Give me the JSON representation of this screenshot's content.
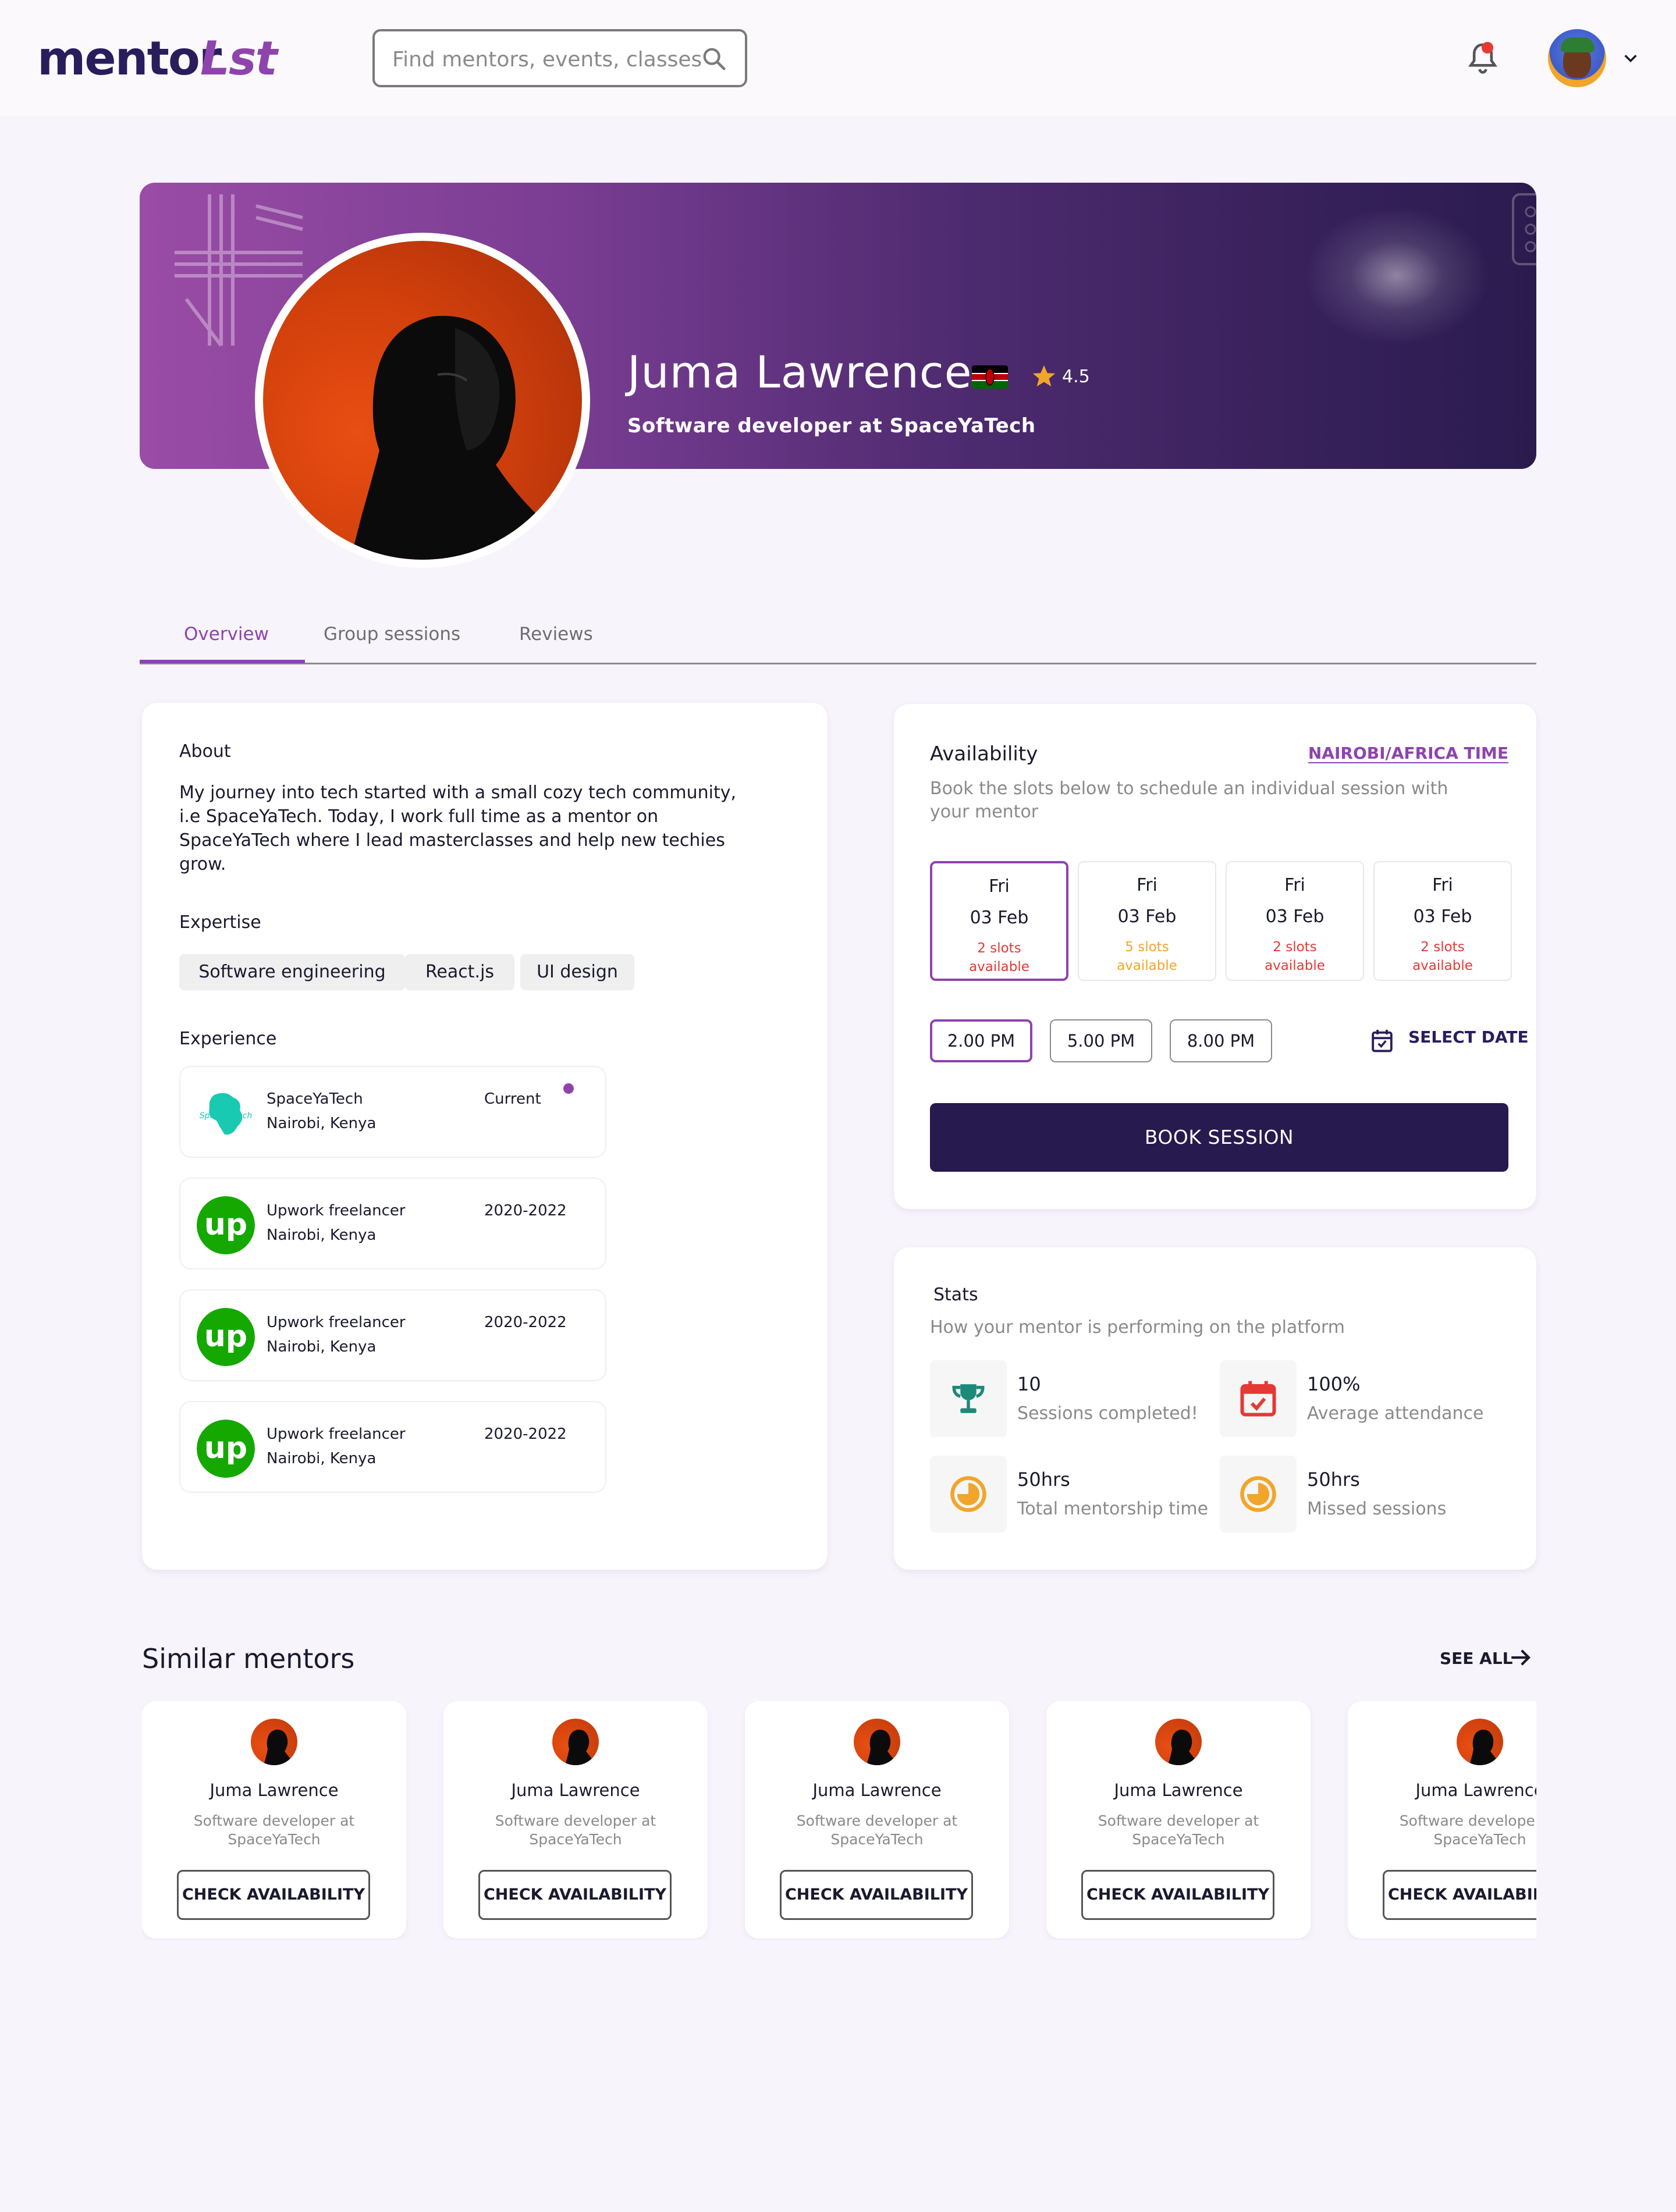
{
  "nav": {
    "logo_text": "mentorLst",
    "search_placeholder": "Find mentors, events, classes"
  },
  "profile": {
    "name": "Juma Lawrence",
    "rating": "4.5",
    "role": "Software developer at SpaceYaTech"
  },
  "tabs": [
    {
      "label": "Overview"
    },
    {
      "label": "Group sessions"
    },
    {
      "label": "Reviews"
    }
  ],
  "about": {
    "title": "About",
    "text": "My journey into tech started with a small cozy tech community, i.e SpaceYaTech. Today, I work full time as a mentor on SpaceYaTech where I lead masterclasses and help new techies grow.",
    "expertise_title": "Expertise",
    "expertise": [
      "Software engineering",
      "React.js",
      "UI design"
    ],
    "experience_title": "Experience",
    "experience": [
      {
        "company": "SpaceYaTech",
        "location": "Nairobi, Kenya",
        "period": "Current"
      },
      {
        "company": "Upwork freelancer",
        "location": "Nairobi, Kenya",
        "period": "2020-2022"
      },
      {
        "company": "Upwork freelancer",
        "location": "Nairobi, Kenya",
        "period": "2020-2022"
      },
      {
        "company": "Upwork freelancer",
        "location": "Nairobi, Kenya",
        "period": "2020-2022"
      }
    ]
  },
  "availability": {
    "title": "Availability",
    "timezone": "NAIROBI/AFRICA TIME",
    "subtitle": "Book the slots below to schedule an individual session with your mentor",
    "days": [
      {
        "day": "Fri",
        "date": "03 Feb",
        "slots": "2 slots available",
        "slot_color": "#E53935"
      },
      {
        "day": "Fri",
        "date": "03 Feb",
        "slots": "5 slots available",
        "slot_color": "#F2A52B"
      },
      {
        "day": "Fri",
        "date": "03 Feb",
        "slots": "2 slots available",
        "slot_color": "#E53935"
      },
      {
        "day": "Fri",
        "date": "03 Feb",
        "slots": "2 slots available",
        "slot_color": "#E53935"
      }
    ],
    "times": [
      "2.00 PM",
      "5.00 PM",
      "8.00 PM"
    ],
    "select_date": "SELECT DATE",
    "book_button": "BOOK SESSION"
  },
  "stats": {
    "title": "Stats",
    "subtitle": "How your mentor is performing on the platform",
    "items": [
      {
        "value": "10",
        "label": "Sessions completed!",
        "icon": "trophy-icon"
      },
      {
        "value": "100%",
        "label": "Average attendance",
        "icon": "calendar-check-icon"
      },
      {
        "value": "50hrs",
        "label": "Total mentorship time",
        "icon": "clock-icon"
      },
      {
        "value": "50hrs",
        "label": "Missed sessions",
        "icon": "clock-icon"
      }
    ]
  },
  "similar": {
    "title": "Similar mentors",
    "see_all": "SEE ALL",
    "mentors": [
      {
        "name": "Juma Lawrence",
        "role": "Software developer at SpaceYaTech",
        "button": "CHECK AVAILABILITY"
      },
      {
        "name": "Juma Lawrence",
        "role": "Software developer at SpaceYaTech",
        "button": "CHECK AVAILABILITY"
      },
      {
        "name": "Juma Lawrence",
        "role": "Software developer at SpaceYaTech",
        "button": "CHECK AVAILABILITY"
      },
      {
        "name": "Juma Lawrence",
        "role": "Software developer at SpaceYaTech",
        "button": "CHECK AVAILABILITY"
      },
      {
        "name": "Juma Lawrence",
        "role": "Software developer at SpaceYaTech",
        "button": "CHECK AVAILABILITY"
      }
    ]
  },
  "colors": {
    "accent": "#8E44AD",
    "primary_dark": "#261A4E",
    "page_bg": "#F8F4FC"
  }
}
